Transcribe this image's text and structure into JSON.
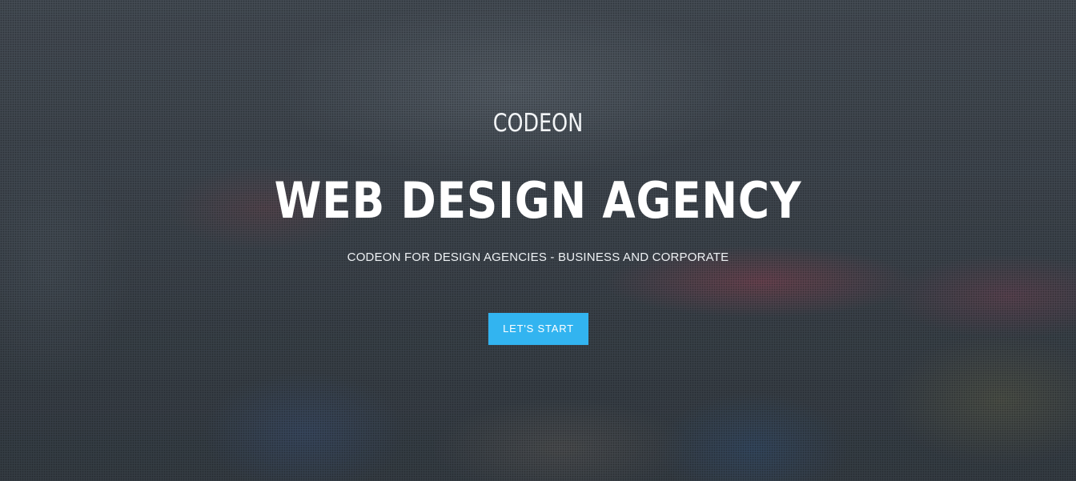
{
  "hero": {
    "brand": "CODEON",
    "headline": "WEB DESIGN AGENCY",
    "subtitle": "CODEON FOR DESIGN AGENCIES - BUSINESS AND CORPORATE",
    "cta_label": "LET'S START"
  },
  "colors": {
    "accent": "#32b4f0",
    "text": "#ffffff",
    "overlay": "#3a4149"
  }
}
